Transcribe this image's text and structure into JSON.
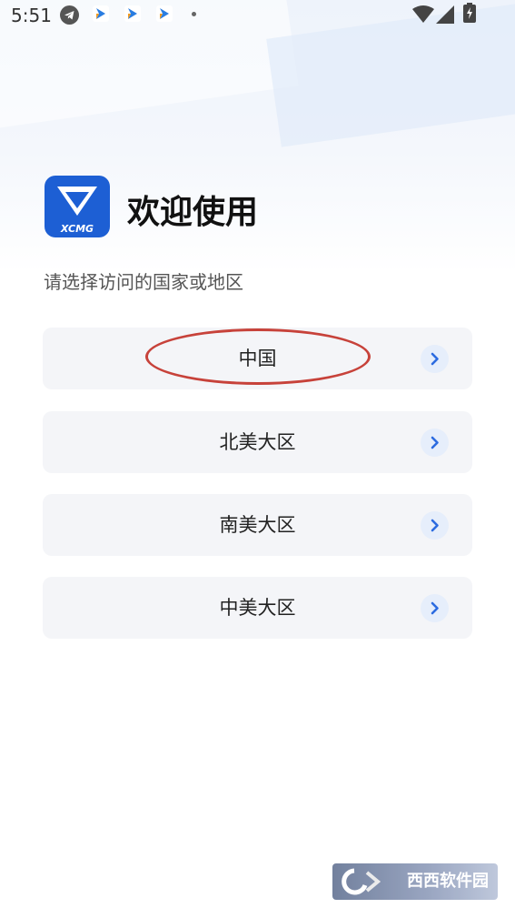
{
  "status_bar": {
    "time": "5:51",
    "icons": [
      "telegram-icon",
      "app-notification-icon",
      "app-notification-icon",
      "app-notification-icon",
      "more-dot-icon",
      "wifi-icon",
      "signal-icon",
      "battery-icon"
    ]
  },
  "header": {
    "logo_text": "XCMG",
    "title": "欢迎使用",
    "subtitle": "请选择访问的国家或地区"
  },
  "regions": [
    {
      "label": "中国",
      "icon": "chevron-right-icon"
    },
    {
      "label": "北美大区",
      "icon": "chevron-right-icon"
    },
    {
      "label": "南美大区",
      "icon": "chevron-right-icon"
    },
    {
      "label": "中美大区",
      "icon": "chevron-right-icon"
    }
  ],
  "watermark": {
    "text": "西西软件园"
  },
  "colors": {
    "brand_blue": "#1d5fd4",
    "accent_blue": "#2c6be0",
    "card_bg": "#f4f5f8",
    "chevron_bg": "#e6eefb",
    "annotation_red": "#c7423a"
  }
}
